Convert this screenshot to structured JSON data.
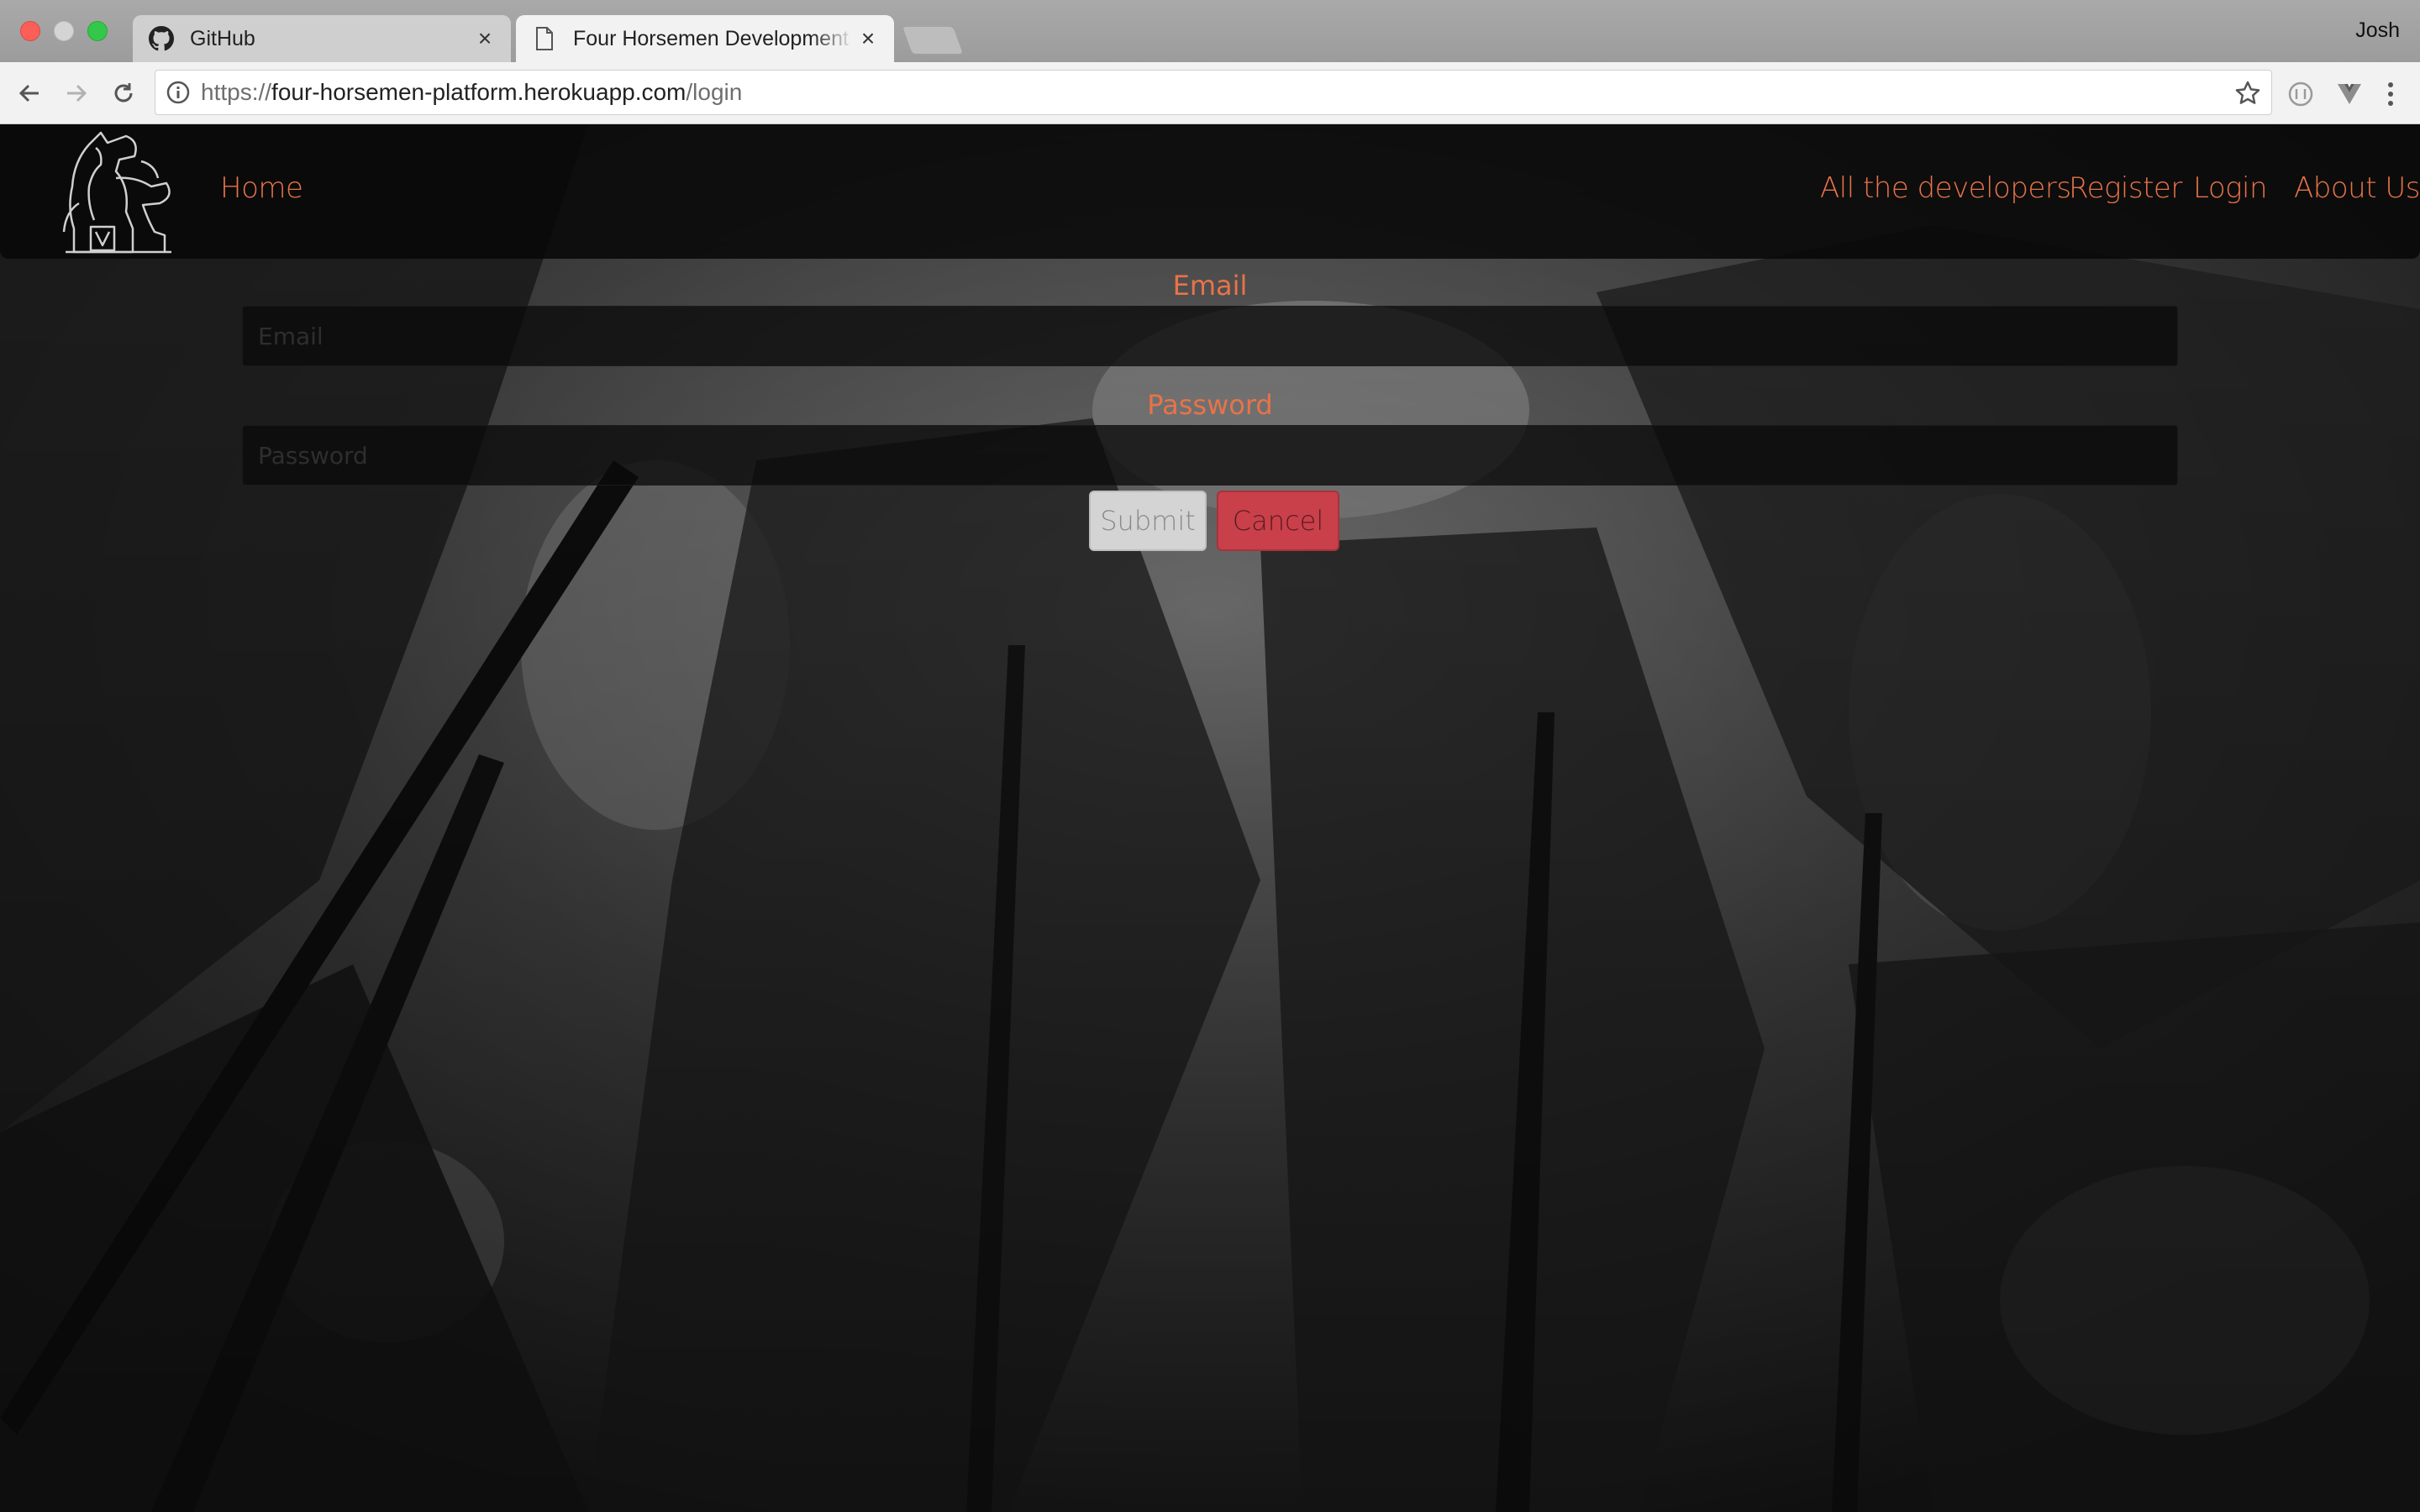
{
  "browser": {
    "tabs": [
      {
        "title": "GitHub",
        "icon": "github-icon",
        "active": false
      },
      {
        "title": "Four Horsemen Development Platform",
        "icon": "page-icon",
        "active": true
      }
    ],
    "profile_name": "Josh",
    "url": {
      "scheme": "https://",
      "host": "four-horsemen-platform.herokuapp.com",
      "path": "/login"
    }
  },
  "navbar": {
    "logo": "four-horsemen-chess-knight-logo",
    "home": "Home",
    "links": {
      "developers": "All the developers",
      "register": "Register",
      "login": "Login",
      "about": "About Us"
    }
  },
  "form": {
    "email_label": "Email",
    "email_placeholder": "Email",
    "password_label": "Password",
    "password_placeholder": "Password",
    "submit_label": "Submit",
    "cancel_label": "Cancel"
  },
  "colors": {
    "accent": "#e8734a",
    "cancel": "#c9404a",
    "submit": "#d4d4d4"
  }
}
